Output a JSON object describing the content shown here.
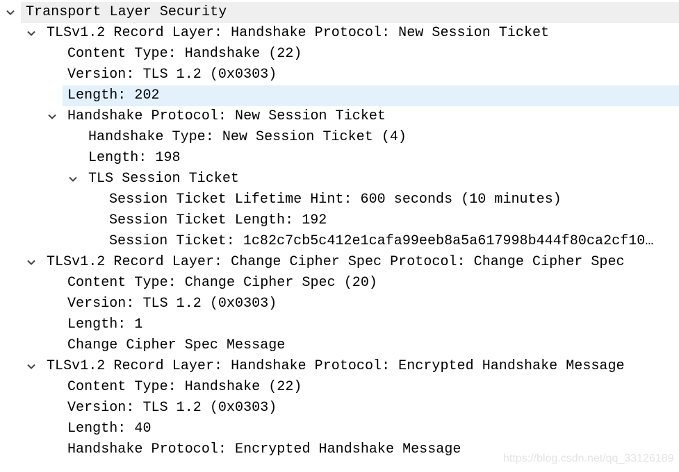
{
  "tree": {
    "rows": [
      {
        "level": 0,
        "expandable": true,
        "expanded": true,
        "state": "hover",
        "text": "Transport Layer Security"
      },
      {
        "level": 1,
        "expandable": true,
        "expanded": true,
        "state": "",
        "text": "TLSv1.2 Record Layer: Handshake Protocol: New Session Ticket"
      },
      {
        "level": 2,
        "expandable": false,
        "state": "",
        "text": "Content Type: Handshake (22)"
      },
      {
        "level": 2,
        "expandable": false,
        "state": "",
        "text": "Version: TLS 1.2 (0x0303)"
      },
      {
        "level": 2,
        "expandable": false,
        "state": "selected",
        "text": "Length: 202"
      },
      {
        "level": 2,
        "expandable": true,
        "expanded": true,
        "state": "",
        "text": "Handshake Protocol: New Session Ticket"
      },
      {
        "level": 3,
        "expandable": false,
        "state": "",
        "text": "Handshake Type: New Session Ticket (4)"
      },
      {
        "level": 3,
        "expandable": false,
        "state": "",
        "text": "Length: 198"
      },
      {
        "level": 3,
        "expandable": true,
        "expanded": true,
        "state": "",
        "text": "TLS Session Ticket"
      },
      {
        "level": 4,
        "expandable": false,
        "state": "",
        "text": "Session Ticket Lifetime Hint: 600 seconds (10 minutes)"
      },
      {
        "level": 4,
        "expandable": false,
        "state": "",
        "text": "Session Ticket Length: 192"
      },
      {
        "level": 4,
        "expandable": false,
        "state": "",
        "text": "Session Ticket: 1c82c7cb5c412e1cafa99eeb8a5a617998b444f80ca2cf10…"
      },
      {
        "level": 1,
        "expandable": true,
        "expanded": true,
        "state": "",
        "text": "TLSv1.2 Record Layer: Change Cipher Spec Protocol: Change Cipher Spec"
      },
      {
        "level": 2,
        "expandable": false,
        "state": "",
        "text": "Content Type: Change Cipher Spec (20)"
      },
      {
        "level": 2,
        "expandable": false,
        "state": "",
        "text": "Version: TLS 1.2 (0x0303)"
      },
      {
        "level": 2,
        "expandable": false,
        "state": "",
        "text": "Length: 1"
      },
      {
        "level": 2,
        "expandable": false,
        "state": "",
        "text": "Change Cipher Spec Message"
      },
      {
        "level": 1,
        "expandable": true,
        "expanded": true,
        "state": "",
        "text": "TLSv1.2 Record Layer: Handshake Protocol: Encrypted Handshake Message"
      },
      {
        "level": 2,
        "expandable": false,
        "state": "",
        "text": "Content Type: Handshake (22)"
      },
      {
        "level": 2,
        "expandable": false,
        "state": "",
        "text": "Version: TLS 1.2 (0x0303)"
      },
      {
        "level": 2,
        "expandable": false,
        "state": "",
        "text": "Length: 40"
      },
      {
        "level": 2,
        "expandable": false,
        "state": "",
        "text": "Handshake Protocol: Encrypted Handshake Message"
      }
    ]
  },
  "colors": {
    "hover_bg": "#efefef",
    "selected_bg": "#e3f1fc",
    "chevron": "#444444"
  },
  "watermark": "https://blog.csdn.net/qq_33126189"
}
